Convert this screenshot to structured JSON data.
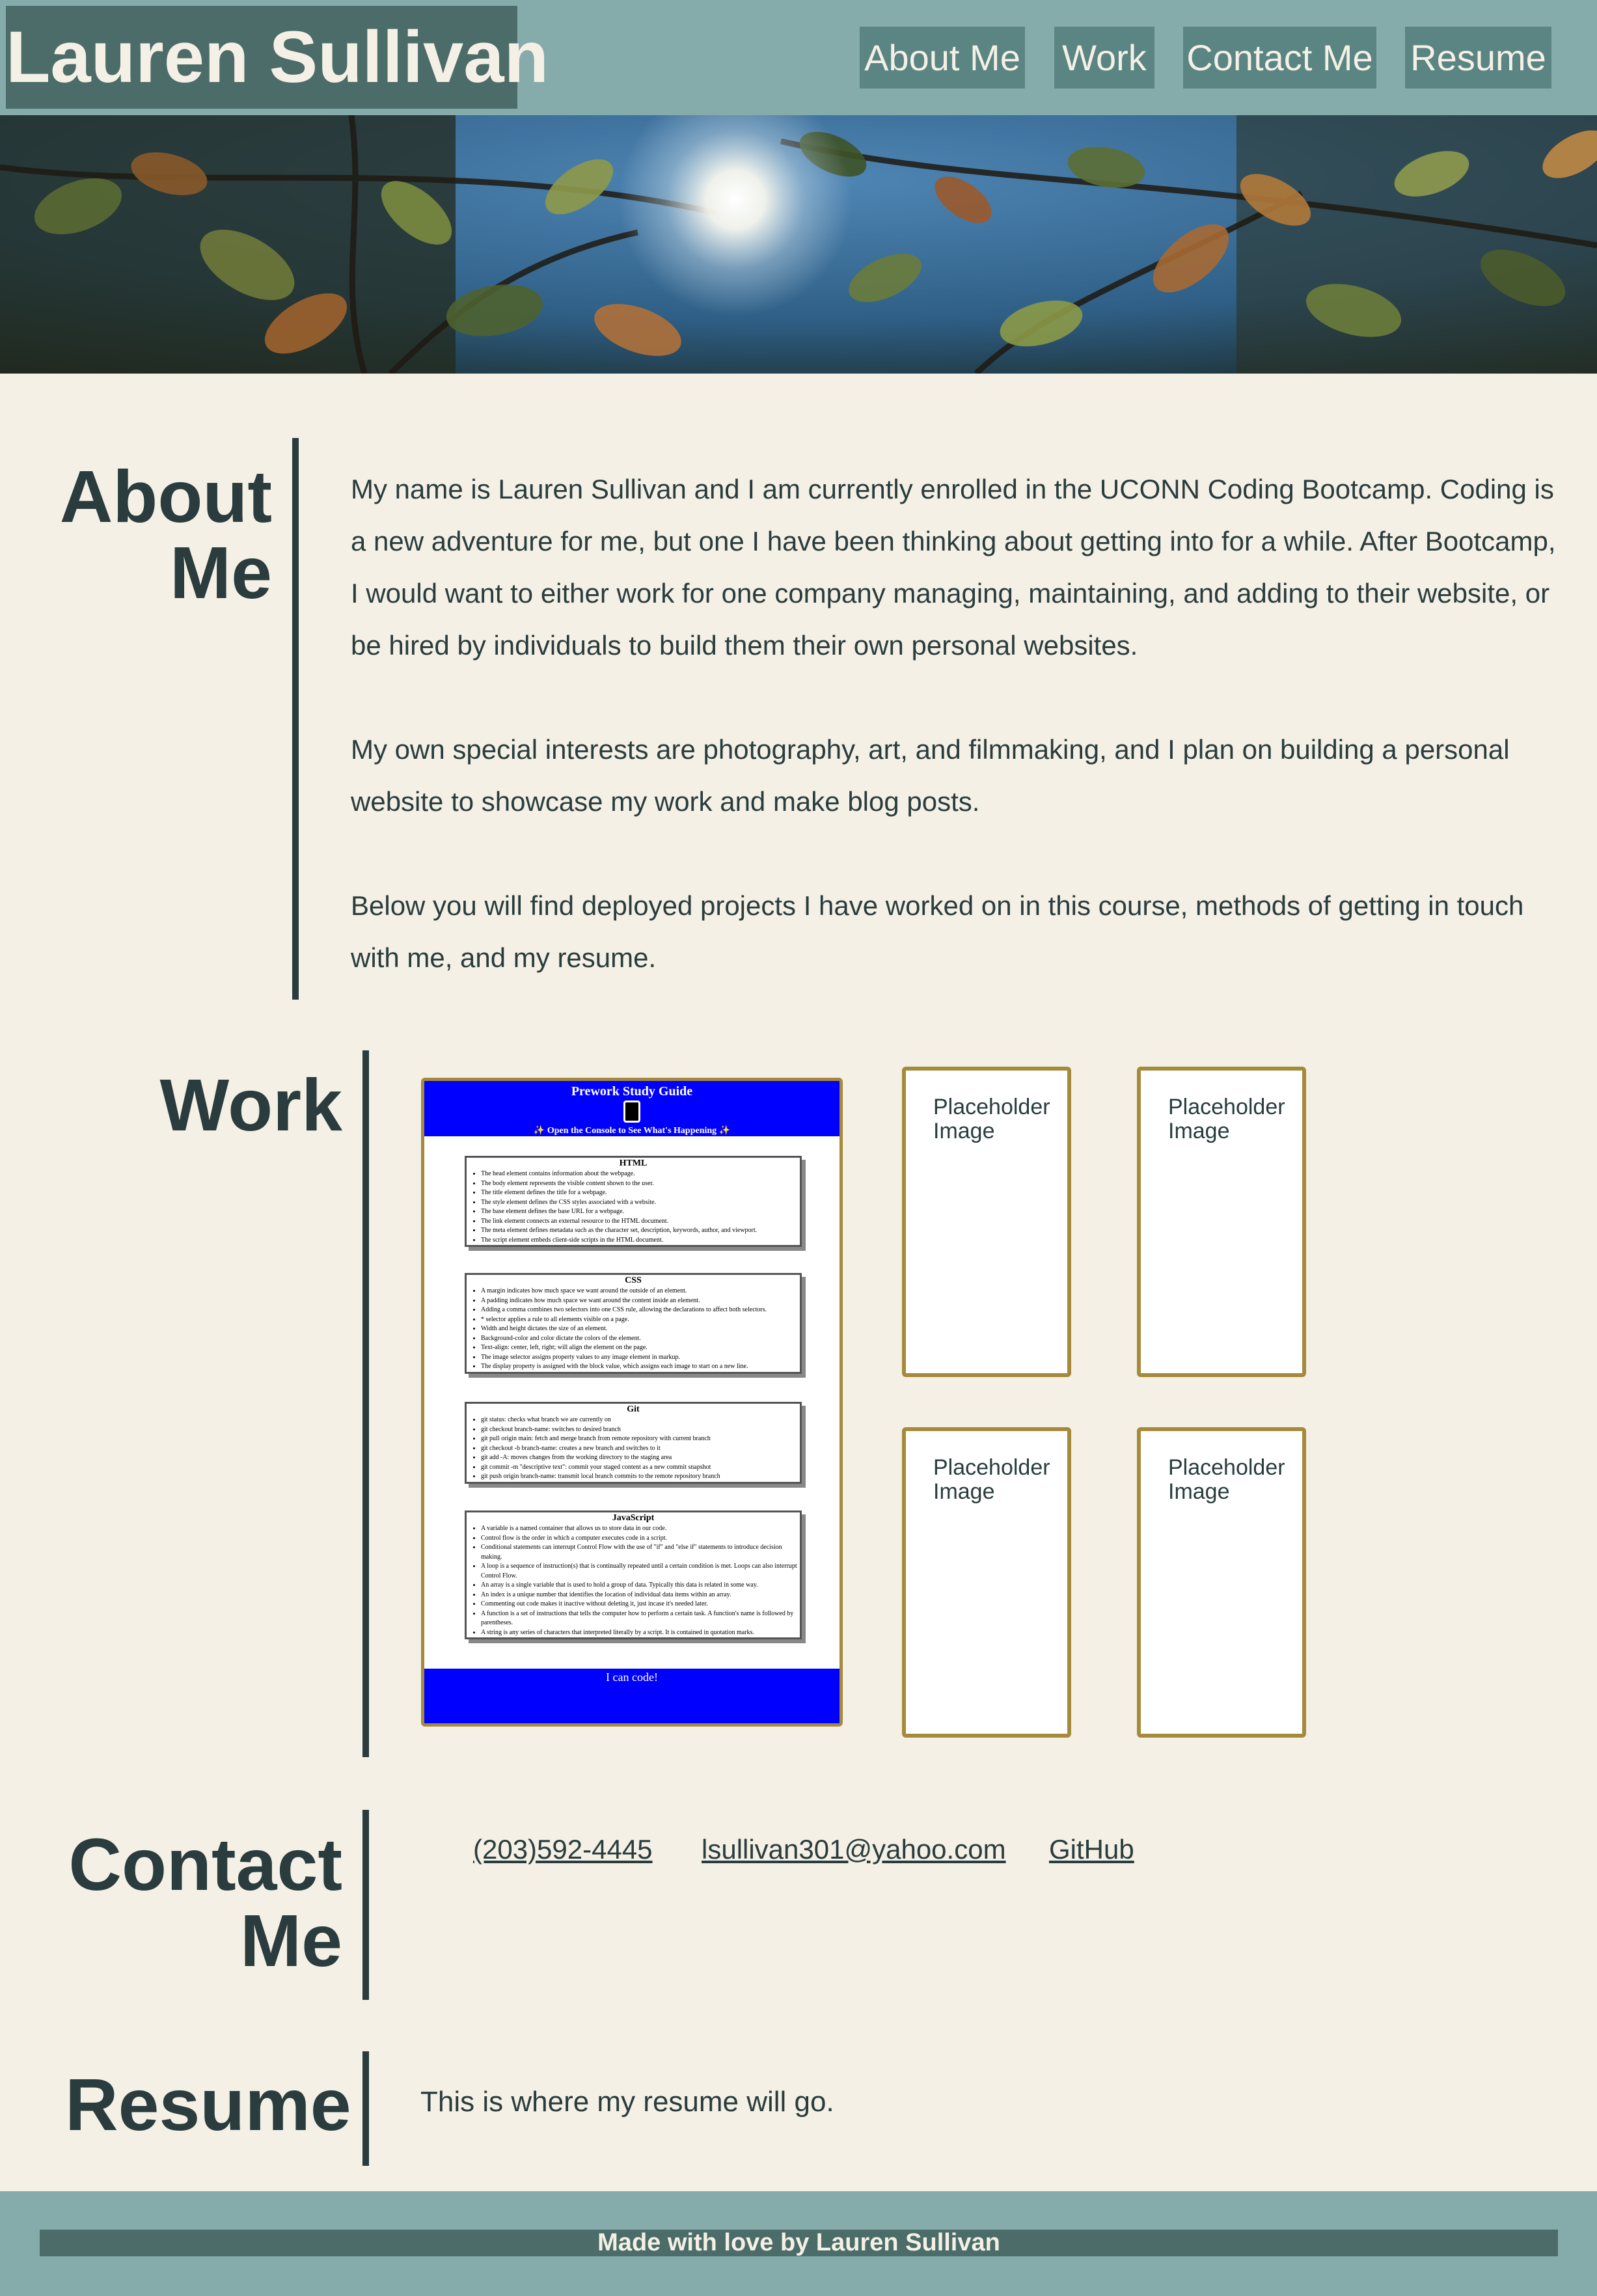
{
  "header": {
    "site_title": "Lauren Sullivan",
    "nav": [
      "About Me",
      "Work",
      "Contact Me",
      "Resume"
    ]
  },
  "about": {
    "heading_line1": "About",
    "heading_line2": "Me",
    "paragraphs": [
      "My name is Lauren Sullivan and I am currently enrolled in the UCONN Coding Bootcamp. Coding is a new adventure for me, but one I have been thinking about getting into for a while. After Bootcamp, I would want to either work for one company managing, maintaining, and adding to their website, or be hired by individuals to build them their own personal websites.",
      "My own special interests are photography, art, and filmmaking, and I plan on building a personal website to showcase my work and make blog posts.",
      "Below you will find deployed projects I have worked on in this course, methods of getting in touch with me, and my resume."
    ]
  },
  "work": {
    "heading": "Work",
    "featured_project": {
      "title": "Prework Study Guide",
      "subtitle": "✨ Open the Console to See What's Happening ✨",
      "footer": "I can code!",
      "cards": [
        {
          "title": "HTML",
          "items": [
            "The head element contains information about the webpage.",
            "The body element represents the visible content shown to the user.",
            "The title element defines the title for a webpage.",
            "The style element defines the CSS styles associated with a website.",
            "The base element defines the base URL for a webpage.",
            "The link element connects an external resource to the HTML document.",
            "The meta element defines metadata such as the character set, description, keywords, author, and viewport.",
            "The script element embeds client-side scripts in the HTML document."
          ]
        },
        {
          "title": "CSS",
          "items": [
            "A margin indicates how much space we want around the outside of an element.",
            "A padding indicates how much space we want around the content inside an element.",
            "Adding a comma combines two selectors into one CSS rule, allowing the declarations to affect both selectors.",
            "* selector applies a rule to all elements visible on a page.",
            "Width and height dictates the size of an element.",
            "Background-color and color dictate the colors of the element.",
            "Text-align: center, left, right; will align the element on the page.",
            "The image selector assigns property values to any image element in markup.",
            "The display property is assigned with the block value, which assigns each image to start on a new line."
          ]
        },
        {
          "title": "Git",
          "items": [
            "git status: checks what branch we are currently on",
            "git checkout branch-name: switches to desired branch",
            "git pull origin main: fetch and merge branch from remote repository with current branch",
            "git checkout -b branch-name: creates a new branch and switches to it",
            "git add -A: moves changes from the working directory to the staging area",
            "git commit -m \"descriptive text\": commit your staged content as a new commit snapshot",
            "git push origin branch-name: transmit local branch commits to the remote repository branch"
          ]
        },
        {
          "title": "JavaScript",
          "items": [
            "A variable is a named container that allows us to store data in our code.",
            "Control flow is the order in which a computer executes code in a script.",
            "Conditional statements can interrupt Control Flow with the use of \"if\" and \"else if\" statements to introduce decision making.",
            "A loop is a sequence of instruction(s) that is continually repeated until a certain condition is met. Loops can also interrupt Control Flow.",
            "An array is a single variable that is used to hold a group of data. Typically this data is related in some way.",
            "An index is a unique number that identifies the location of individual data items within an array.",
            "Commenting out code makes it inactive without deleting it, just incase it's needed later.",
            "A function is a set of instructions that tells the computer how to perform a certain task. A function's name is followed by parentheses.",
            "A string is any series of characters that interpreted literally by a script. It is contained in quotation marks."
          ]
        }
      ]
    },
    "placeholders": [
      "Placeholder Image",
      "Placeholder Image",
      "Placeholder Image",
      "Placeholder Image"
    ]
  },
  "contact": {
    "heading_line1": "Contact",
    "heading_line2": "Me",
    "phone": "(203)592-4445",
    "email": "lsullivan301@yahoo.com",
    "github": "GitHub"
  },
  "resume": {
    "heading": "Resume",
    "text": "This is where my resume will go."
  },
  "footer": {
    "text": "Made with love by Lauren Sullivan"
  },
  "colors": {
    "background": "#f4f0e5",
    "header": "#86abab",
    "title_block": "#4b6c69",
    "nav_button": "#5a8583",
    "text": "#2a3c3d",
    "card_border": "#a6893a",
    "project_blue": "#0000ff"
  }
}
